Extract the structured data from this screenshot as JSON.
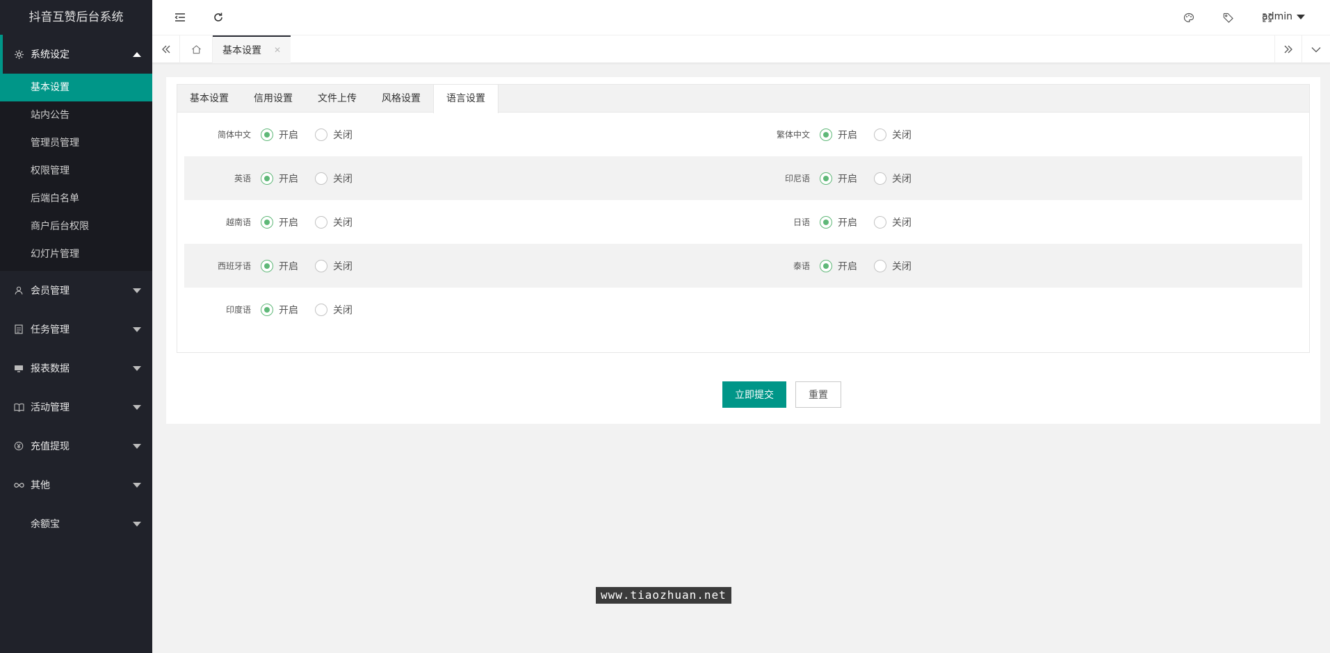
{
  "sidebar": {
    "logo": "抖音互赞后台系统",
    "groups": [
      {
        "label": "系统设定",
        "icon": "gear-icon",
        "open": true,
        "items": [
          "基本设置",
          "站内公告",
          "管理员管理",
          "权限管理",
          "后端白名单",
          "商户后台权限",
          "幻灯片管理"
        ]
      },
      {
        "label": "会员管理",
        "icon": "user-icon"
      },
      {
        "label": "任务管理",
        "icon": "document-icon"
      },
      {
        "label": "报表数据",
        "icon": "chart-icon"
      },
      {
        "label": "活动管理",
        "icon": "book-icon"
      },
      {
        "label": "充值提现",
        "icon": "yen-icon"
      },
      {
        "label": "其他",
        "icon": "infinity-icon"
      },
      {
        "label": "余额宝",
        "icon": ""
      }
    ]
  },
  "topbar": {
    "user": "admin",
    "icons": [
      "menu-toggle-icon",
      "refresh-icon",
      "theme-icon",
      "tag-icon",
      "fullscreen-icon"
    ]
  },
  "page_tabs": {
    "current": "基本设置"
  },
  "form": {
    "tabs": [
      "基本设置",
      "信用设置",
      "文件上传",
      "风格设置",
      "语言设置"
    ],
    "active_tab": 4,
    "on_label": "开启",
    "off_label": "关闭",
    "languages": [
      {
        "label": "简体中文",
        "value": "on"
      },
      {
        "label": "繁体中文",
        "value": "on"
      },
      {
        "label": "英语",
        "value": "on"
      },
      {
        "label": "印尼语",
        "value": "on"
      },
      {
        "label": "越南语",
        "value": "on"
      },
      {
        "label": "日语",
        "value": "on"
      },
      {
        "label": "西班牙语",
        "value": "on"
      },
      {
        "label": "泰语",
        "value": "on"
      },
      {
        "label": "印度语",
        "value": "on"
      }
    ],
    "submit_label": "立即提交",
    "reset_label": "重置"
  },
  "watermark": "www.tiaozhuan.net",
  "colors": {
    "accent": "#009688",
    "sidebar_bg": "#20222a",
    "radio_on": "#5fb878"
  }
}
